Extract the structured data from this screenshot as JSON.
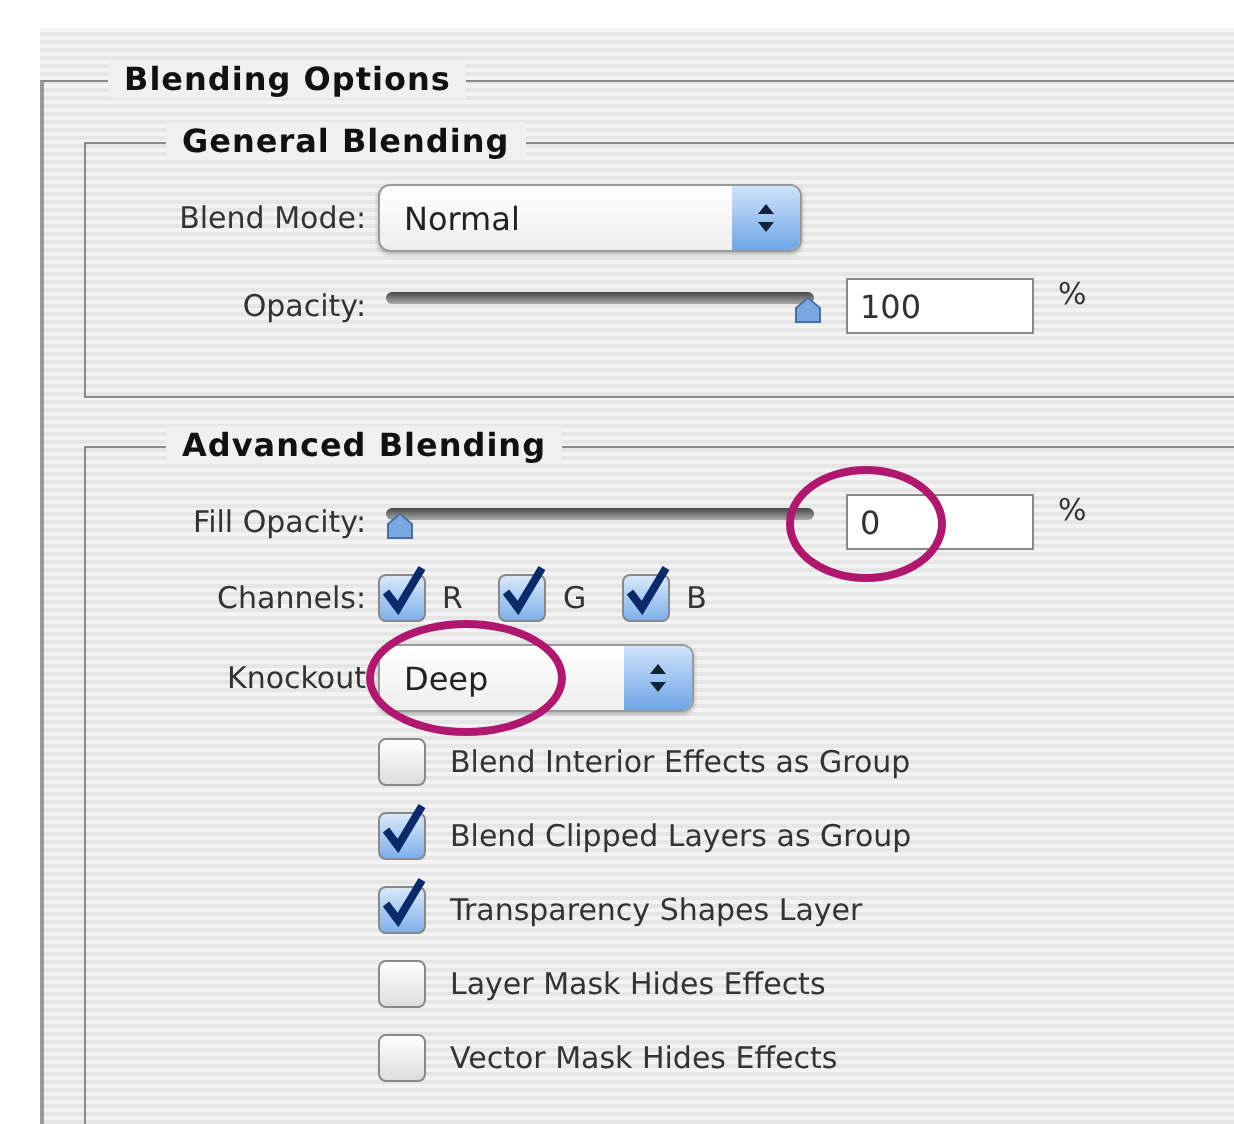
{
  "title": "Blending Options",
  "general": {
    "title": "General Blending",
    "blend_mode": {
      "label": "Blend Mode:",
      "value": "Normal"
    },
    "opacity": {
      "label": "Opacity:",
      "level": 1,
      "value": "100",
      "unit": "%"
    }
  },
  "advanced": {
    "title": "Advanced Blending",
    "fill_opacity": {
      "label": "Fill Opacity:",
      "level": 0,
      "value": "0",
      "unit": "%",
      "highlighted": true
    },
    "channels": {
      "label": "Channels:",
      "items": [
        {
          "label": "R",
          "checked": true
        },
        {
          "label": "G",
          "checked": true
        },
        {
          "label": "B",
          "checked": true
        }
      ]
    },
    "knockout": {
      "label": "Knockout",
      "value": "Deep",
      "highlighted": true
    },
    "options": [
      {
        "label": "Blend Interior Effects as Group",
        "checked": false
      },
      {
        "label": "Blend Clipped Layers as Group",
        "checked": true
      },
      {
        "label": "Transparency Shapes Layer",
        "checked": true
      },
      {
        "label": "Layer Mask Hides Effects",
        "checked": false
      },
      {
        "label": "Vector Mask Hides Effects",
        "checked": false
      }
    ]
  }
}
